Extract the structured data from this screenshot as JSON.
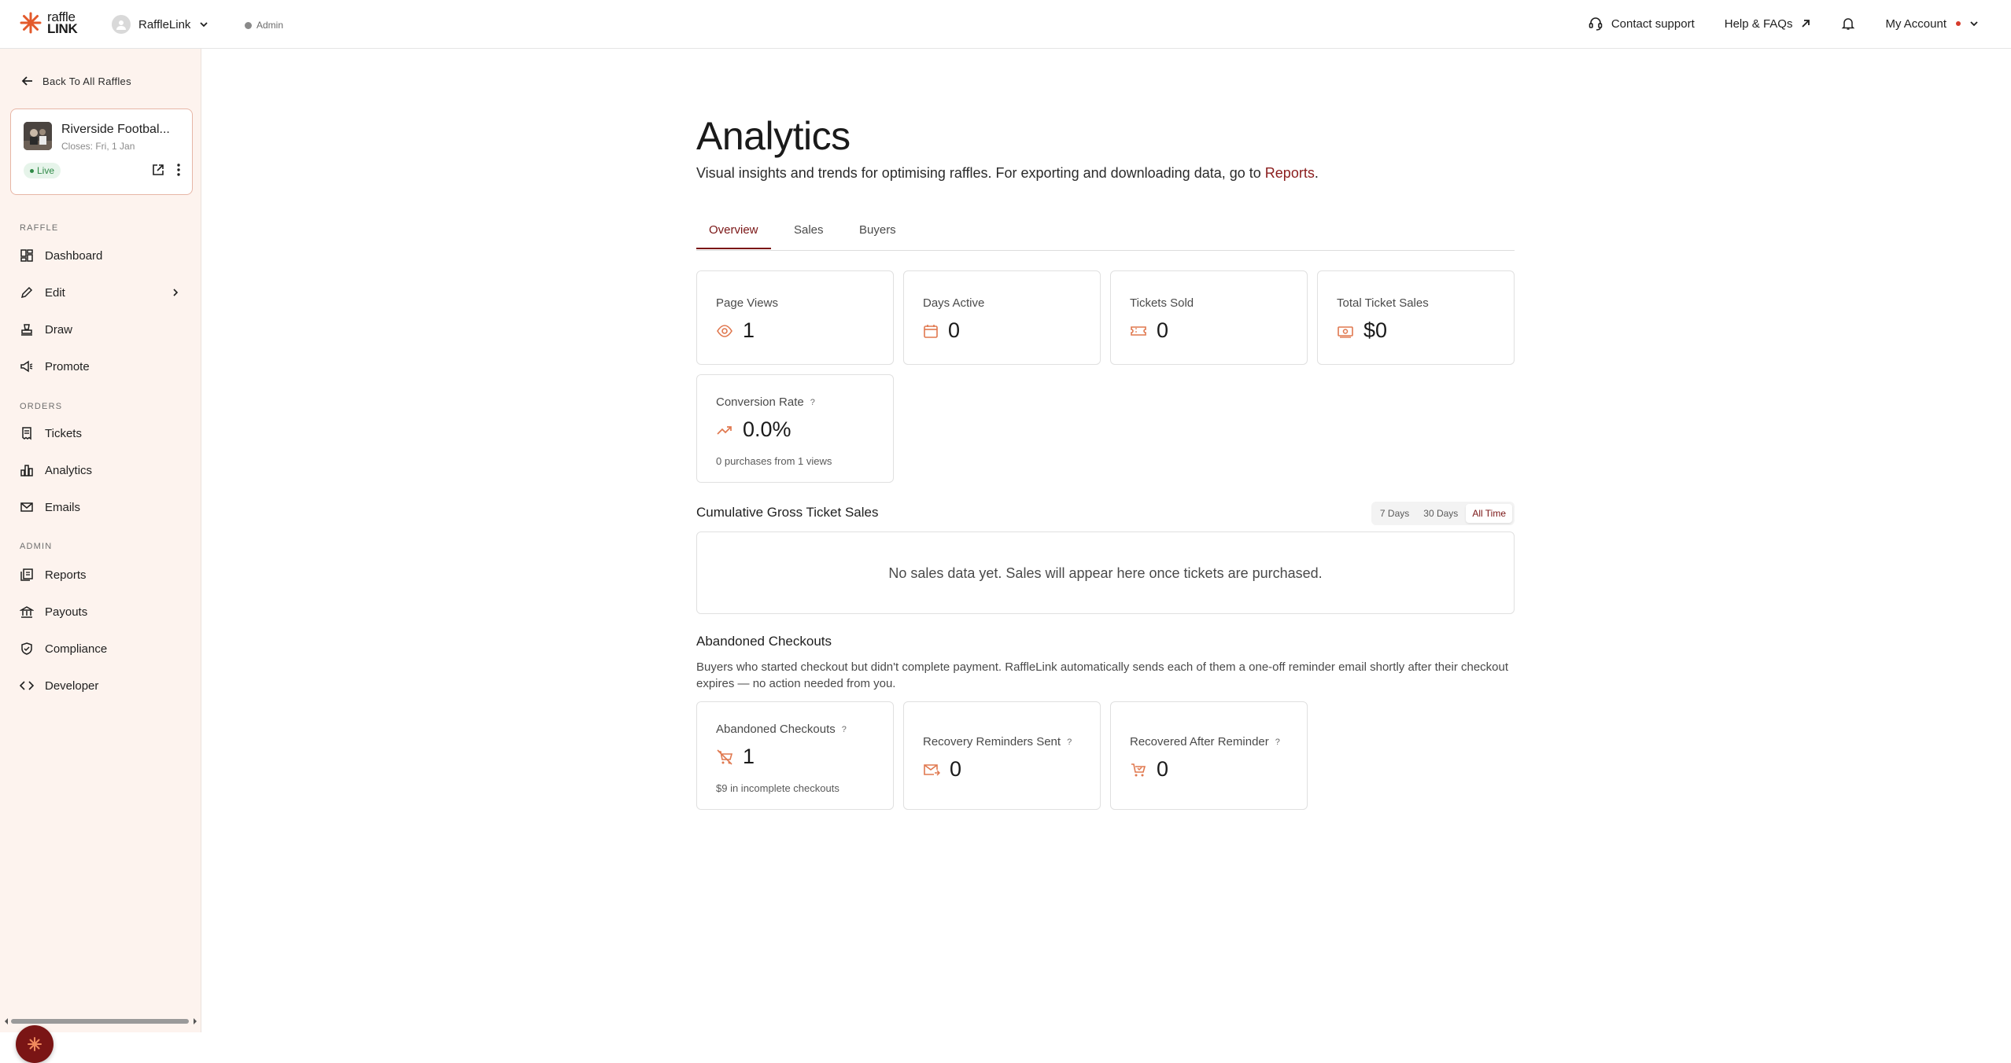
{
  "brand": {
    "logo_line1": "raffle",
    "logo_line2": "LINK"
  },
  "header": {
    "org_name": "RaffleLink",
    "role_badge": "Admin",
    "contact": "Contact support",
    "help": "Help & FAQs",
    "account": "My Account"
  },
  "sidebar": {
    "back": "Back To All Raffles",
    "raffle": {
      "name": "Riverside Footbal...",
      "closes": "Closes: Fri, 1 Jan",
      "status": "Live"
    },
    "sections": {
      "raffle": "RAFFLE",
      "orders": "ORDERS",
      "admin": "ADMIN"
    },
    "items": {
      "dashboard": "Dashboard",
      "edit": "Edit",
      "draw": "Draw",
      "promote": "Promote",
      "tickets": "Tickets",
      "analytics": "Analytics",
      "emails": "Emails",
      "reports": "Reports",
      "payouts": "Payouts",
      "compliance": "Compliance",
      "developer": "Developer"
    }
  },
  "main": {
    "title": "Analytics",
    "subtitle": "Visual insights and trends for optimising raffles. For exporting and downloading data, go to",
    "subtitle_link": "Reports",
    "subtitle_end": ".",
    "tabs": [
      "Overview",
      "Sales",
      "Buyers"
    ],
    "active_tab": "Overview",
    "stats": {
      "page_views": {
        "label": "Page Views",
        "value": "1"
      },
      "days_active": {
        "label": "Days Active",
        "value": "0"
      },
      "tickets_sold": {
        "label": "Tickets Sold",
        "value": "0"
      },
      "total_sales": {
        "label": "Total Ticket Sales",
        "value": "$0"
      },
      "conversion": {
        "label": "Conversion Rate",
        "help": "?",
        "value": "0.0%",
        "foot": "0 purchases from 1 views"
      }
    },
    "chart": {
      "title": "Cumulative Gross Ticket Sales",
      "ranges": [
        "7 Days",
        "30 Days",
        "All Time"
      ],
      "selected_range": "All Time",
      "empty": "No sales data yet. Sales will appear here once tickets are purchased."
    },
    "abandoned": {
      "title": "Abandoned Checkouts",
      "description": "Buyers who started checkout but didn't complete payment. RaffleLink automatically sends each of them a one-off reminder email shortly after their checkout expires — no action needed from you.",
      "checkouts": {
        "label": "Abandoned Checkouts",
        "help": "?",
        "value": "1",
        "foot": "$9 in incomplete checkouts"
      },
      "reminders": {
        "label": "Recovery Reminders Sent",
        "help": "?",
        "value": "0"
      },
      "recovered": {
        "label": "Recovered After Reminder",
        "help": "?",
        "value": "0"
      }
    }
  },
  "colors": {
    "accent": "#7a1515",
    "icon_orange": "#e0784f",
    "sidebar_bg": "#fdf3ee",
    "live_green": "#2f8a47"
  }
}
